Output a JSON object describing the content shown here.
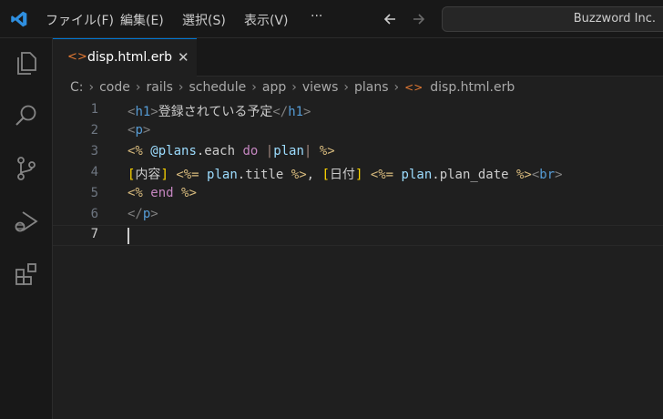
{
  "window": {
    "menu": [
      "ファイル(F)",
      "編集(E)",
      "選択(S)",
      "表示(V)"
    ],
    "more": "···",
    "search_label": "Buzzword Inc."
  },
  "tab": {
    "label": "disp.html.erb",
    "close": "✕"
  },
  "breadcrumb": [
    "C:",
    "code",
    "rails",
    "schedule",
    "app",
    "views",
    "plans",
    "disp.html.erb"
  ],
  "editor": {
    "line_numbers": [
      "1",
      "2",
      "3",
      "4",
      "5",
      "6",
      "7"
    ],
    "lines": [
      "<h1>登録されている予定</h1>",
      "<p>",
      "<% @plans.each do |plan| %>",
      "[内容] <%= plan.title %>, [日付] <%= plan.plan_date %><br>",
      "<% end %>",
      "</p>",
      ""
    ],
    "current_line": 7
  },
  "colors": {
    "accent": "#0078d4",
    "erb_file_icon": "#e37933",
    "tag": "#569cd6",
    "keyword": "#c586c0",
    "variable": "#9cdcfe",
    "bracket": "#ffd700"
  },
  "icons": {
    "activity_bar": [
      "explorer-icon",
      "search-icon",
      "source-control-icon",
      "run-debug-icon",
      "extensions-icon"
    ]
  }
}
